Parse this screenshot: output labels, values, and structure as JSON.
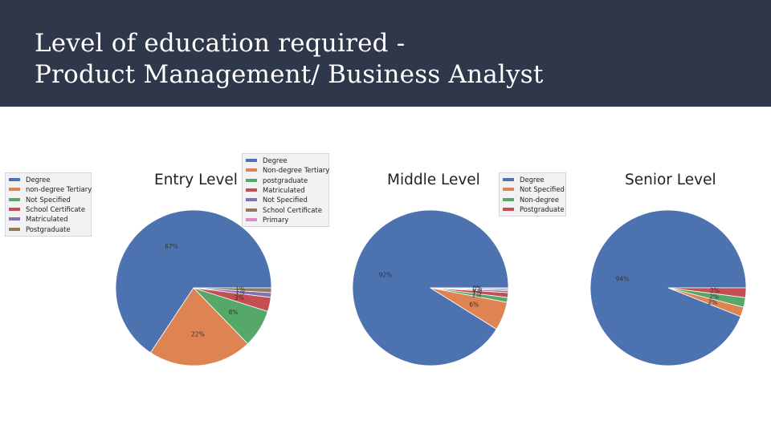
{
  "slide": {
    "title_line1": "Level of education required -",
    "title_line2": "Product Management/ Business Analyst"
  },
  "chart_data": [
    {
      "type": "pie",
      "title": "Entry Level",
      "legend": [
        "Degree",
        "non-degree Tertiary",
        "Not Specified",
        "School Certificate",
        "Matriculated",
        "Postgraduate"
      ],
      "legend_placement": "left",
      "slices": [
        {
          "name": "Degree",
          "value": 67,
          "label": "67%",
          "color": "#4c72b0"
        },
        {
          "name": "non-degree Tertiary",
          "value": 22,
          "label": "22%",
          "color": "#dd8452"
        },
        {
          "name": "Not Specified",
          "value": 8,
          "label": "8%",
          "color": "#55a868"
        },
        {
          "name": "School Certificate",
          "value": 3,
          "label": "3%",
          "color": "#c44e52"
        },
        {
          "name": "Matriculated",
          "value": 1,
          "label": "1%",
          "color": "#8172b3"
        },
        {
          "name": "Postgraduate",
          "value": 1,
          "label": "1%",
          "color": "#937860"
        }
      ]
    },
    {
      "type": "pie",
      "title": "Middle Level",
      "legend": [
        "Degree",
        "Non-degree Tertiary",
        "postgraduate",
        "Matriculated",
        "Not Specified",
        "School Certificate",
        "Primary"
      ],
      "legend_placement": "top-left",
      "slices": [
        {
          "name": "Degree",
          "value": 92,
          "label": "92%",
          "color": "#4c72b0"
        },
        {
          "name": "Non-degree Tertiary",
          "value": 6,
          "label": "6%",
          "color": "#dd8452"
        },
        {
          "name": "postgraduate",
          "value": 1,
          "label": "1%",
          "color": "#55a868"
        },
        {
          "name": "Matriculated",
          "value": 1,
          "label": "1%",
          "color": "#c44e52"
        },
        {
          "name": "Not Specified",
          "value": 0.4,
          "label": "0%",
          "color": "#8172b3"
        },
        {
          "name": "School Certificate",
          "value": 0.3,
          "label": "0%",
          "color": "#937860"
        },
        {
          "name": "Primary",
          "value": 0.3,
          "label": "0%",
          "color": "#da8bc3"
        }
      ]
    },
    {
      "type": "pie",
      "title": "Senior Level",
      "legend": [
        "Degree",
        "Not Specified",
        "Non-degree",
        "Postgraduate"
      ],
      "legend_placement": "top-left",
      "slices": [
        {
          "name": "Degree",
          "value": 94,
          "label": "94%",
          "color": "#4c72b0"
        },
        {
          "name": "Not Specified",
          "value": 2,
          "label": "2%",
          "color": "#dd8452"
        },
        {
          "name": "Non-degree",
          "value": 2,
          "label": "2%",
          "color": "#55a868"
        },
        {
          "name": "Postgraduate",
          "value": 2,
          "label": "2%",
          "color": "#c44e52"
        }
      ]
    }
  ]
}
